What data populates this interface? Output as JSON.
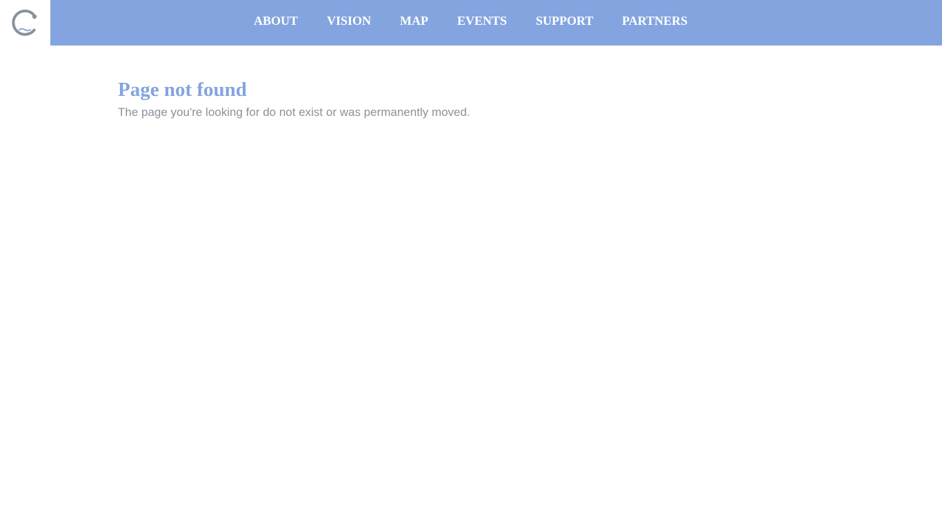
{
  "colors": {
    "accent": "#84a4e0",
    "logo_gray": "#8a9199",
    "text_gray": "#8a9199",
    "nav_text": "#ffffff",
    "background": "#ffffff"
  },
  "logo": {
    "icon": "c-logo-icon"
  },
  "nav": {
    "items": [
      {
        "label": "ABOUT"
      },
      {
        "label": "VISION"
      },
      {
        "label": "MAP"
      },
      {
        "label": "EVENTS"
      },
      {
        "label": "SUPPORT"
      },
      {
        "label": "PARTNERS"
      }
    ]
  },
  "main": {
    "title": "Page not found",
    "message": "The page you're looking for do not exist or was permanently moved."
  }
}
